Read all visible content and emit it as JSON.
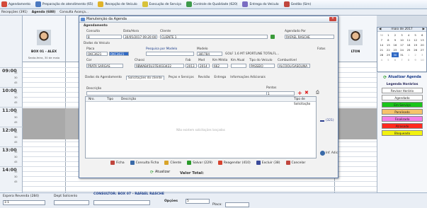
{
  "toolbar": {
    "items": [
      {
        "label": "Agendamento",
        "icon": "calendar-icon",
        "color": "#d34a3a"
      },
      {
        "label": "Preparação de atendimento (65)",
        "icon": "wrench-icon",
        "color": "#4a78c0"
      },
      {
        "label": "Recepção de Veículo",
        "icon": "car-icon",
        "color": "#e0b32a"
      },
      {
        "label": "Execução de Serviço",
        "icon": "tools-icon",
        "color": "#d8c23a"
      },
      {
        "label": "Controle de Qualidade (620)",
        "icon": "check-icon",
        "color": "#3e9a4b"
      },
      {
        "label": "Entrega do Veículo",
        "icon": "key-icon",
        "color": "#7a6cc2"
      },
      {
        "label": "Gestão (Sim)",
        "icon": "chart-icon",
        "color": "#c0463d"
      }
    ]
  },
  "secbar": {
    "items": [
      "Recepções (391)",
      "Agenda (688)",
      "Consulta Avança..."
    ]
  },
  "times": [
    "09:00",
    "10:00",
    "11:00",
    "12:00",
    "13:00",
    "14:00"
  ],
  "mins": [
    "15",
    "30",
    "45"
  ],
  "columns": {
    "first": {
      "name": "BOX 01 - ALEX",
      "sub": "Sexta-feira, 30 de maio"
    },
    "last": {
      "name": "LTON"
    }
  },
  "calendar": {
    "title": "maio de 2017",
    "days": [
      "30",
      "1",
      "2",
      "3",
      "4",
      "5",
      "6",
      "7",
      "8",
      "9",
      "10",
      "11",
      "12",
      "13",
      "14",
      "15",
      "16",
      "17",
      "18",
      "19",
      "20",
      "21",
      "22",
      "23",
      "24",
      "25",
      "26",
      "27",
      "28",
      "29",
      "30",
      "31",
      "1",
      "2",
      "3",
      "4",
      "5",
      "6",
      "7",
      "8",
      "9",
      "10"
    ]
  },
  "legend": {
    "update": "Atualizar Agenda",
    "title": "Legenda Horários",
    "items": [
      {
        "label": "Revisar Horário",
        "color": "#ffffff"
      },
      {
        "label": "Agendado",
        "color": "#ffffff"
      },
      {
        "label": "Em Serviço",
        "color": "#1ac51a"
      },
      {
        "label": "Paralisado",
        "color": "#f6c36b"
      },
      {
        "label": "Finalizado",
        "color": "#f27fe8"
      },
      {
        "label": "Atrasado",
        "color": "#ff2a1f"
      },
      {
        "label": "Bloqueado",
        "color": "#f2f20f"
      }
    ]
  },
  "modal": {
    "title": "Manutenção da Agenda",
    "section_agendamento": "Agendamento",
    "labels": {
      "consulta": "Consulta",
      "data_hora": "Data/Hora",
      "cliente": "Cliente",
      "agendado_por": "Agendado Por",
      "dados_veiculo": "Dados do Veículo",
      "placa": "Placa",
      "pesquisa_modelo": "Pesquisa por Modelo",
      "modelo": "Modelo",
      "cor": "Cor",
      "chassi": "Chassi",
      "fab": "Fab",
      "mod": "Mod",
      "km_media": "Km Média",
      "km_atual": "Km Atual",
      "tipo_veiculo": "Tipo do Veículo",
      "combustivel": "Combustível",
      "descricao": "Descrição",
      "pontos": "Pontos",
      "fotos": "Fotos"
    },
    "values": {
      "consulta": "8",
      "data_hora": "30/05/2017 09:20:00",
      "cliente": "CLIENTE 1",
      "agendado_por": "RAFAEL RASCHE",
      "placa": "OKC3621",
      "placa2": "OKC3621",
      "modelo": "381784",
      "modelo_desc": "GOLF 1.6 MT SPORTLINE TOTALFL...",
      "cor": "PRATA SARGAS",
      "chassi": "9BWAB45U37E4033422",
      "fab": "2013",
      "mod": "2014",
      "km_media": "662",
      "km_atual": "",
      "tipo_veiculo": "PASSEIO",
      "combustivel": "ALCOOL/GASOLINA",
      "pontos": "1"
    },
    "tabs": [
      "Dados do Agendamento",
      "Solicitações do cliente",
      "Peças e Serviços",
      "Revisão",
      "Entrega",
      "Informações Adicionais"
    ],
    "table": {
      "headers": [
        "Nro.",
        "Tipo",
        "Descrição",
        "Tipo de Solicitação"
      ],
      "empty": "Não existem solicitações lançadas"
    },
    "side": {
      "count": "(321)",
      "inf": "Inf. Adic."
    },
    "actions": [
      "Ficha",
      "Consulta Ficha",
      "Cliente",
      "Salvar (229)",
      "Reagendar (410)",
      "Excluir (38)",
      "Cancelar"
    ],
    "available": "Atualizar",
    "valor_total": "Valor Total:"
  },
  "bottom": {
    "espera": "Espera Revenda (284)",
    "espera_val": "1:1",
    "depto": "Dept Solicenlo",
    "consultor": "CONSULTOR: BOX 07 - RAFAEL RASCHE",
    "options": "Opções",
    "option_val": "5",
    "placa": "Placa:"
  }
}
